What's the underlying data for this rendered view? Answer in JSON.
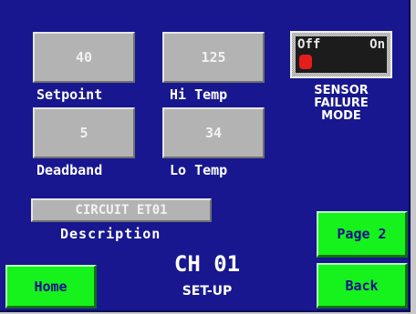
{
  "setpoint": {
    "value": "40",
    "label": "Setpoint"
  },
  "hi_temp": {
    "value": "125",
    "label": "Hi Temp"
  },
  "deadband": {
    "value": "5",
    "label": "Deadband"
  },
  "lo_temp": {
    "value": "34",
    "label": "Lo Temp"
  },
  "sensor_failure": {
    "off_label": "Off",
    "on_label": "On",
    "state": "Off",
    "caption_lines": [
      "SENSOR",
      "FAILURE",
      "MODE"
    ]
  },
  "description": {
    "value": "CIRCUIT ET01",
    "label": "Description"
  },
  "channel": {
    "title": "CH 01",
    "subtitle": "SET-UP"
  },
  "buttons": {
    "home": "Home",
    "page2": "Page 2",
    "back": "Back"
  },
  "colors": {
    "background": "#18178f",
    "field": "#b3b3b3",
    "button": "#16f21c",
    "knob": "#e41d1d"
  }
}
